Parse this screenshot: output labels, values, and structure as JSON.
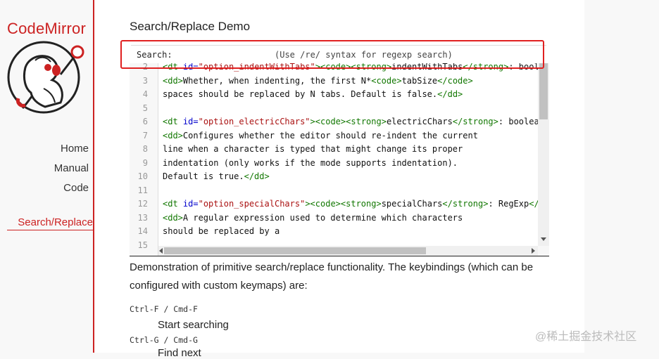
{
  "sidebar": {
    "logo_text": "CodeMirror",
    "nav": [
      "Home",
      "Manual",
      "Code"
    ],
    "active": "Search/Replace"
  },
  "main": {
    "title": "Search/Replace Demo",
    "search": {
      "label": "Search:",
      "value": "",
      "hint": "(Use /re/ syntax for regexp search)"
    },
    "editor": {
      "lines": [
        {
          "n": "2",
          "segs": [
            [
              "tag",
              "<dt "
            ],
            [
              "attr",
              "id="
            ],
            [
              "str",
              "\"option_indentWithTabs\""
            ],
            [
              "tag",
              ">"
            ],
            [
              "tag",
              "<code>"
            ],
            [
              "tag",
              "<strong>"
            ],
            [
              "plain",
              "indentWithTabs"
            ],
            [
              "tag",
              "</strong>"
            ],
            [
              "plain",
              ": boolea"
            ]
          ]
        },
        {
          "n": "3",
          "segs": [
            [
              "tag",
              "<dd>"
            ],
            [
              "plain",
              "Whether, when indenting, the first N*"
            ],
            [
              "tag",
              "<code>"
            ],
            [
              "plain",
              "tabSize"
            ],
            [
              "tag",
              "</code>"
            ]
          ]
        },
        {
          "n": "4",
          "segs": [
            [
              "plain",
              "spaces should be replaced by N tabs. Default is false."
            ],
            [
              "tag",
              "</dd>"
            ]
          ]
        },
        {
          "n": "5",
          "segs": []
        },
        {
          "n": "6",
          "segs": [
            [
              "tag",
              "<dt "
            ],
            [
              "attr",
              "id="
            ],
            [
              "str",
              "\"option_electricChars\""
            ],
            [
              "tag",
              ">"
            ],
            [
              "tag",
              "<code>"
            ],
            [
              "tag",
              "<strong>"
            ],
            [
              "plain",
              "electricChars"
            ],
            [
              "tag",
              "</strong>"
            ],
            [
              "plain",
              ": boolean"
            ],
            [
              "tag",
              "<"
            ]
          ]
        },
        {
          "n": "7",
          "segs": [
            [
              "tag",
              "<dd>"
            ],
            [
              "plain",
              "Configures whether the editor should re-indent the current"
            ]
          ]
        },
        {
          "n": "8",
          "segs": [
            [
              "plain",
              "line when a character is typed that might change its proper"
            ]
          ]
        },
        {
          "n": "9",
          "segs": [
            [
              "plain",
              "indentation (only works if the mode supports indentation)."
            ]
          ]
        },
        {
          "n": "10",
          "segs": [
            [
              "plain",
              "Default is true."
            ],
            [
              "tag",
              "</dd>"
            ]
          ]
        },
        {
          "n": "11",
          "segs": []
        },
        {
          "n": "12",
          "segs": [
            [
              "tag",
              "<dt "
            ],
            [
              "attr",
              "id="
            ],
            [
              "str",
              "\"option_specialChars\""
            ],
            [
              "tag",
              ">"
            ],
            [
              "tag",
              "<code>"
            ],
            [
              "tag",
              "<strong>"
            ],
            [
              "plain",
              "specialChars"
            ],
            [
              "tag",
              "</strong>"
            ],
            [
              "plain",
              ": RegExp"
            ],
            [
              "tag",
              "</co"
            ]
          ]
        },
        {
          "n": "13",
          "segs": [
            [
              "tag",
              "<dd>"
            ],
            [
              "plain",
              "A regular expression used to determine which characters"
            ]
          ]
        },
        {
          "n": "14",
          "segs": [
            [
              "plain",
              "should be replaced by a"
            ]
          ]
        },
        {
          "n": "15",
          "segs": []
        }
      ]
    },
    "description": "Demonstration of primitive search/replace functionality. The keybindings (which can be configured with custom keymaps) are:",
    "keybindings": [
      {
        "keys": "Ctrl-F / Cmd-F",
        "desc": "Start searching"
      },
      {
        "keys": "Ctrl-G / Cmd-G",
        "desc": "Find next"
      }
    ]
  },
  "watermark": "@稀土掘金技术社区",
  "colors": {
    "accent": "#cc2222",
    "highlight_box": "#e02020",
    "tag": "#117700",
    "attr": "#0000cc",
    "string": "#aa1111"
  }
}
